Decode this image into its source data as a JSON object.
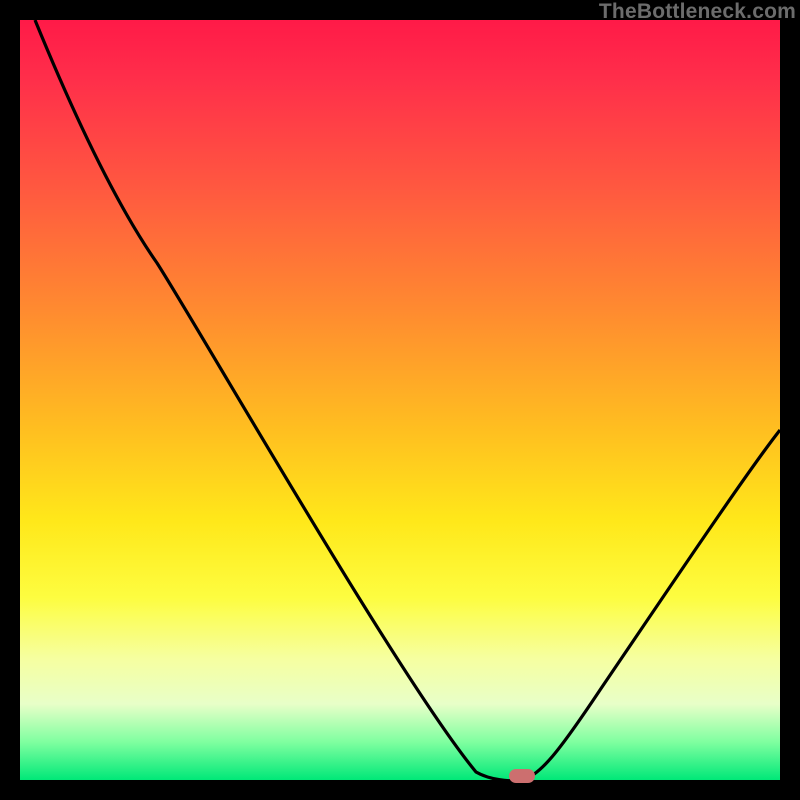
{
  "watermark": "TheBottleneck.com",
  "chart_data": {
    "type": "line",
    "title": "",
    "xlabel": "",
    "ylabel": "",
    "xlim": [
      0,
      100
    ],
    "ylim": [
      0,
      100
    ],
    "series": [
      {
        "name": "bottleneck-curve",
        "points": [
          {
            "x": 2,
            "y": 100
          },
          {
            "x": 13,
            "y": 76
          },
          {
            "x": 18,
            "y": 68
          },
          {
            "x": 60,
            "y": 1
          },
          {
            "x": 66,
            "y": 0
          },
          {
            "x": 70,
            "y": 1
          },
          {
            "x": 100,
            "y": 46
          }
        ]
      }
    ],
    "optimum_marker": {
      "x": 66,
      "y": 0.5
    },
    "gradient_stops": [
      {
        "pct": 0,
        "color": "#ff1a48"
      },
      {
        "pct": 50,
        "color": "#ffcf20"
      },
      {
        "pct": 80,
        "color": "#fdfd60"
      },
      {
        "pct": 100,
        "color": "#00e878"
      }
    ]
  }
}
